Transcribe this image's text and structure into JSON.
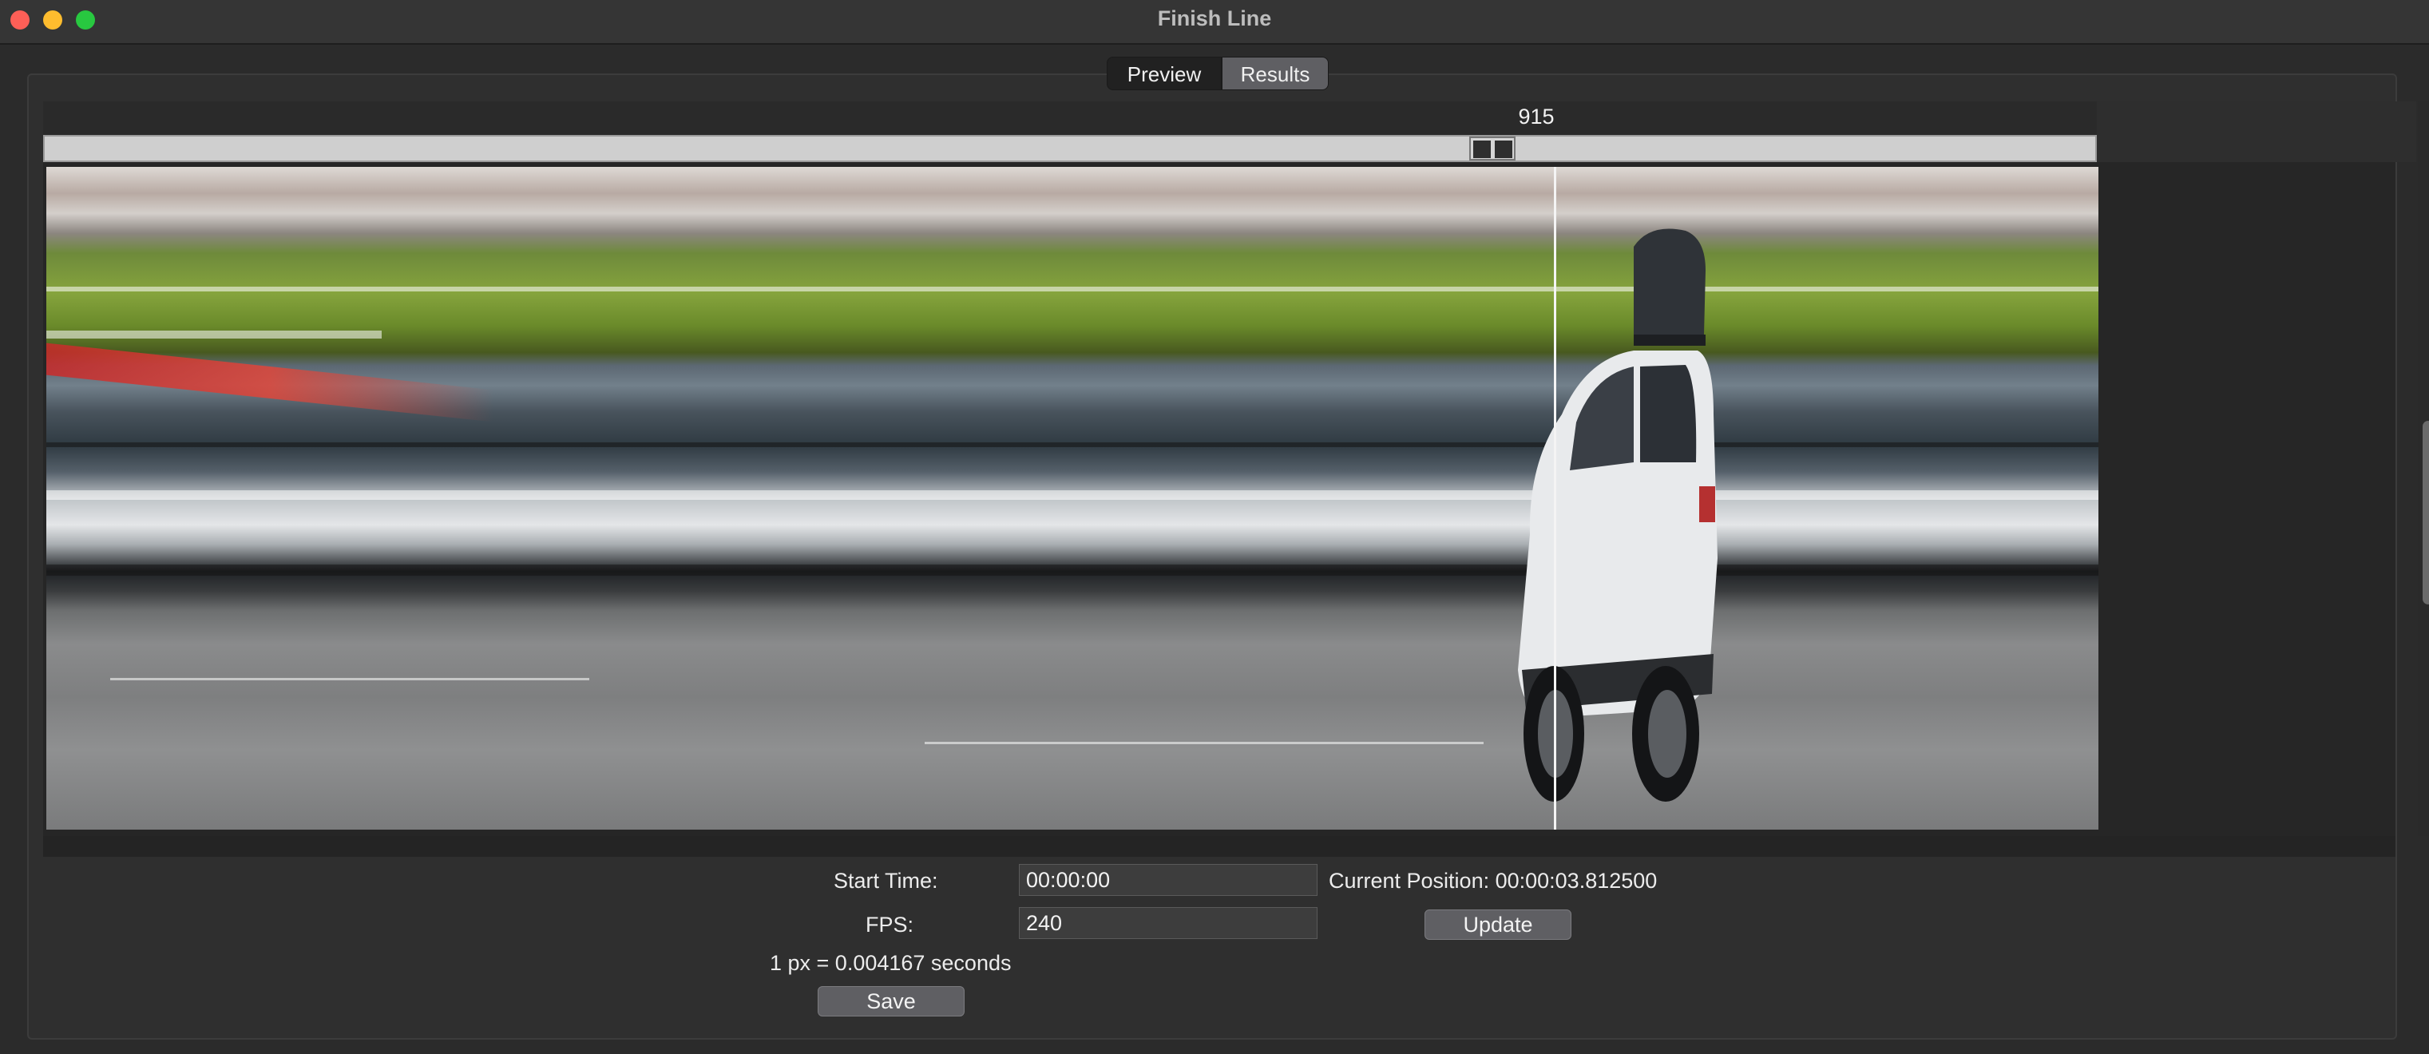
{
  "window": {
    "title": "Finish Line"
  },
  "tabs": [
    {
      "label": "Preview",
      "active": false
    },
    {
      "label": "Results",
      "active": true
    }
  ],
  "viewer": {
    "frame_number": "915",
    "image": "photo-finish strip of a white SUV crossing the finish line"
  },
  "controls": {
    "start_time_label": "Start Time:",
    "start_time_value": "00:00:00",
    "current_position": "Current Position: 00:00:03.812500",
    "fps_label": "FPS:",
    "fps_value": "240",
    "update_label": "Update",
    "px_info": "1 px = 0.004167 seconds",
    "save_label": "Save"
  },
  "colors": {
    "background": "#2b2b2b",
    "active_tab": "#5f5f63",
    "button": "#5f5f63",
    "finish_line": "#f4f4f4"
  }
}
